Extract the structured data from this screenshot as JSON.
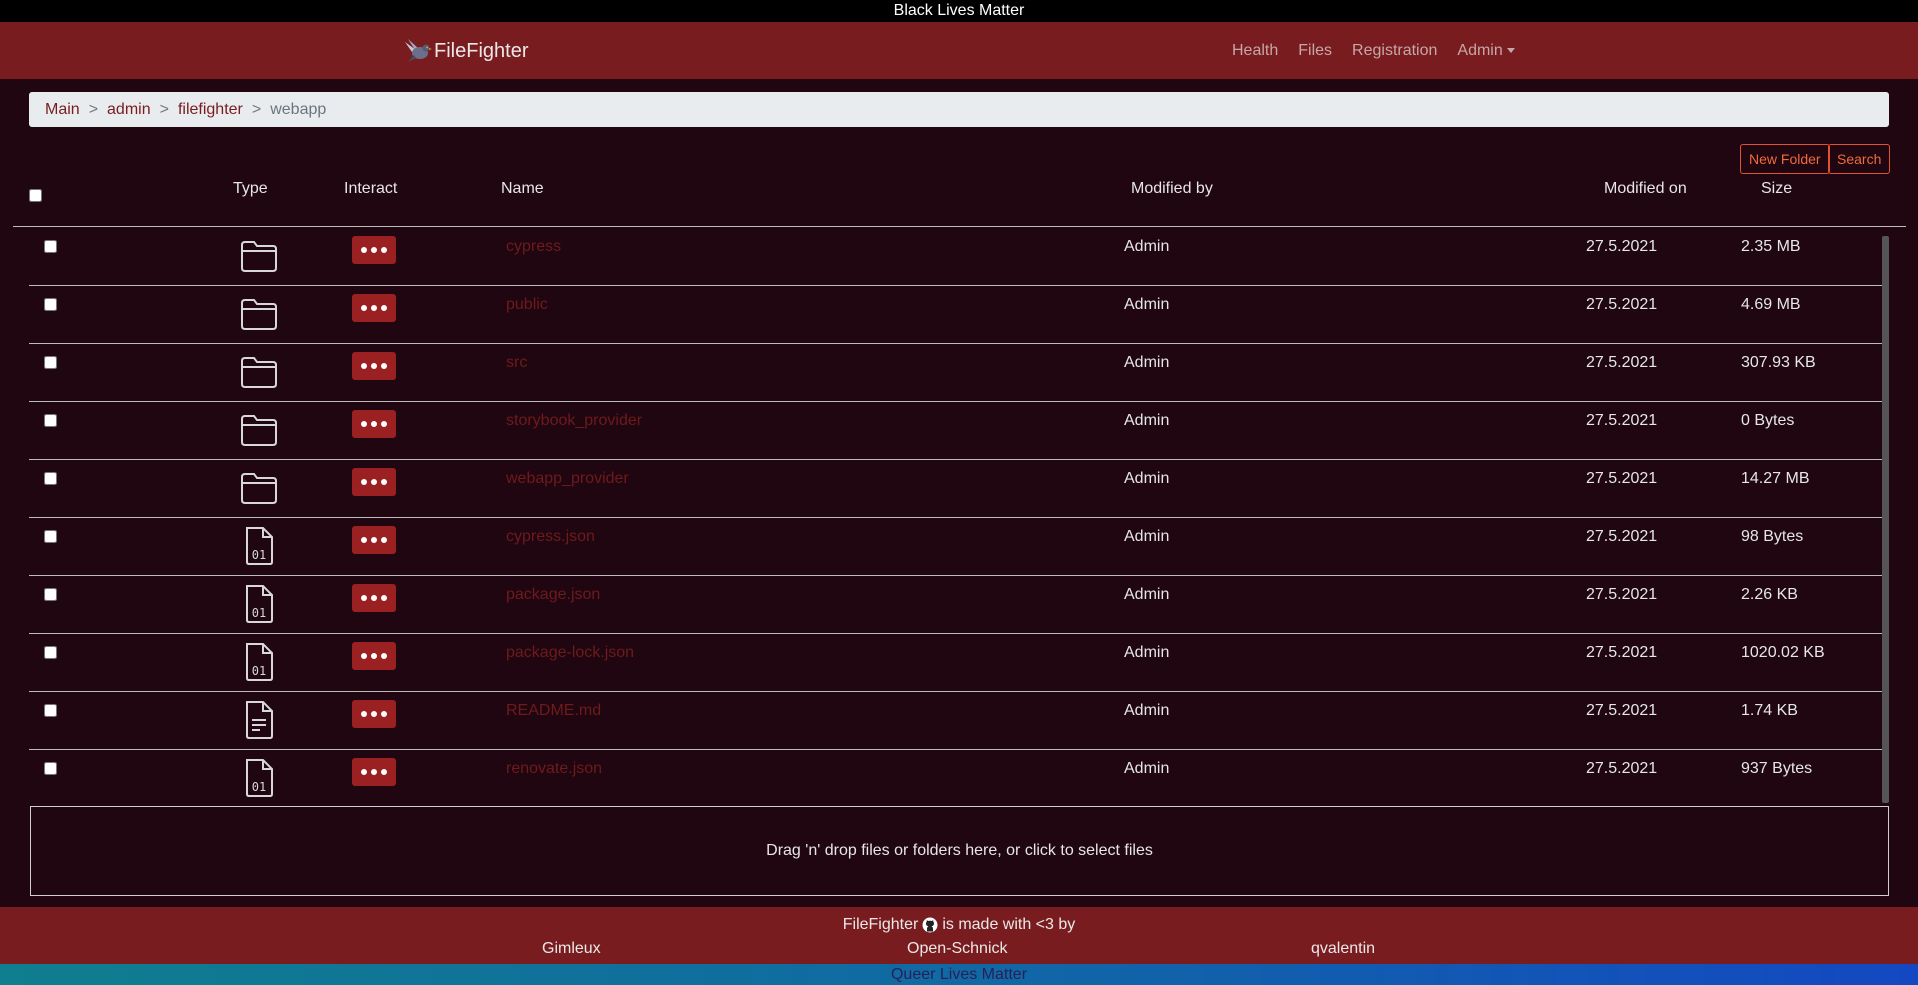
{
  "banner_top": "Black Lives Matter",
  "banner_bottom": "Queer Lives Matter",
  "navbar": {
    "brand": "FileFighter",
    "brand_logo_icon": "pigeon-logo",
    "links": [
      "Health",
      "Files",
      "Registration"
    ],
    "admin_dropdown": "Admin"
  },
  "breadcrumb": {
    "items": [
      "Main",
      "admin",
      "filefighter"
    ],
    "separator": ">",
    "current": "webapp"
  },
  "actions": {
    "new_folder": "New Folder",
    "search": "Search"
  },
  "table": {
    "headers": {
      "type": "Type",
      "interact": "Interact",
      "name": "Name",
      "modified_by": "Modified by",
      "modified_on": "Modified on",
      "size": "Size"
    },
    "rows": [
      {
        "type": "folder",
        "name": "cypress",
        "modified_by": "Admin",
        "modified_on": "27.5.2021",
        "size": "2.35 MB"
      },
      {
        "type": "folder",
        "name": "public",
        "modified_by": "Admin",
        "modified_on": "27.5.2021",
        "size": "4.69 MB"
      },
      {
        "type": "folder",
        "name": "src",
        "modified_by": "Admin",
        "modified_on": "27.5.2021",
        "size": "307.93 KB"
      },
      {
        "type": "folder",
        "name": "storybook_provider",
        "modified_by": "Admin",
        "modified_on": "27.5.2021",
        "size": "0 Bytes"
      },
      {
        "type": "folder",
        "name": "webapp_provider",
        "modified_by": "Admin",
        "modified_on": "27.5.2021",
        "size": "14.27 MB"
      },
      {
        "type": "binary-file",
        "name": "cypress.json",
        "modified_by": "Admin",
        "modified_on": "27.5.2021",
        "size": "98 Bytes"
      },
      {
        "type": "binary-file",
        "name": "package.json",
        "modified_by": "Admin",
        "modified_on": "27.5.2021",
        "size": "2.26 KB"
      },
      {
        "type": "binary-file",
        "name": "package-lock.json",
        "modified_by": "Admin",
        "modified_on": "27.5.2021",
        "size": "1020.02 KB"
      },
      {
        "type": "text-file",
        "name": "README.md",
        "modified_by": "Admin",
        "modified_on": "27.5.2021",
        "size": "1.74 KB"
      },
      {
        "type": "binary-file",
        "name": "renovate.json",
        "modified_by": "Admin",
        "modified_on": "27.5.2021",
        "size": "937 Bytes"
      }
    ]
  },
  "dropzone": "Drag 'n' drop files or folders here, or click to select files",
  "footer": {
    "brand": "FileFighter",
    "made_with": "is made with <3 by",
    "contributors": [
      "Gimleux",
      "Open-Schnick",
      "qvalentin"
    ]
  },
  "colors": {
    "background": "#1f0610",
    "navbar": "#781c1f",
    "interact_button": "#9a2022",
    "outline_button": "#e2522e"
  }
}
